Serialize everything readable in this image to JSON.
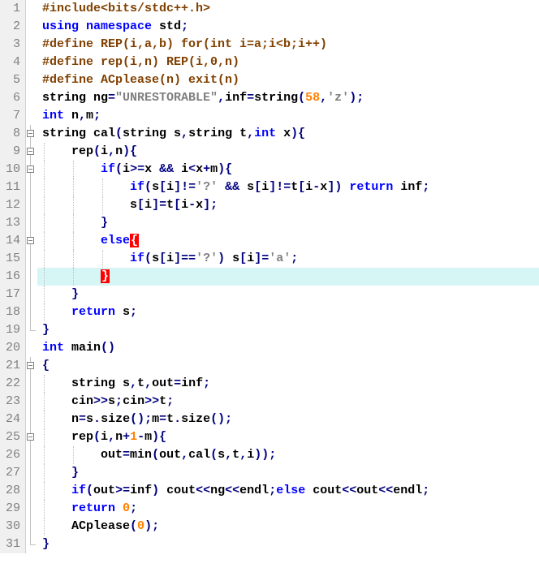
{
  "chart_data": {
    "type": "table",
    "title": "C++ source code listing",
    "lines": [
      {
        "n": 1,
        "fold": "",
        "tokens": [
          [
            "pp",
            "#include<bits/stdc++.h>"
          ]
        ]
      },
      {
        "n": 2,
        "fold": "",
        "tokens": [
          [
            "kw",
            "using"
          ],
          [
            "tok",
            " "
          ],
          [
            "kw",
            "namespace"
          ],
          [
            "tok",
            " std"
          ],
          [
            "pun",
            ";"
          ]
        ]
      },
      {
        "n": 3,
        "fold": "",
        "tokens": [
          [
            "pp",
            "#define REP(i,a,b) for(int i=a;i<b;i++)"
          ]
        ]
      },
      {
        "n": 4,
        "fold": "",
        "tokens": [
          [
            "pp",
            "#define rep(i,n) REP(i,0,n)"
          ]
        ]
      },
      {
        "n": 5,
        "fold": "",
        "tokens": [
          [
            "pp",
            "#define ACplease(n) exit(n)"
          ]
        ]
      },
      {
        "n": 6,
        "fold": "",
        "tokens": [
          [
            "tok",
            "string ng"
          ],
          [
            "pun",
            "="
          ],
          [
            "str",
            "\"UNRESTORABLE\""
          ],
          [
            "pun",
            ","
          ],
          [
            "tok",
            "inf"
          ],
          [
            "pun",
            "="
          ],
          [
            "tok",
            "string"
          ],
          [
            "pun",
            "("
          ],
          [
            "num",
            "58"
          ],
          [
            "pun",
            ","
          ],
          [
            "str",
            "'z'"
          ],
          [
            "pun",
            ");"
          ]
        ]
      },
      {
        "n": 7,
        "fold": "",
        "tokens": [
          [
            "kw",
            "int"
          ],
          [
            "tok",
            " n"
          ],
          [
            "pun",
            ","
          ],
          [
            "tok",
            "m"
          ],
          [
            "pun",
            ";"
          ]
        ]
      },
      {
        "n": 8,
        "fold": "box",
        "tokens": [
          [
            "tok",
            "string cal"
          ],
          [
            "pun",
            "("
          ],
          [
            "tok",
            "string s"
          ],
          [
            "pun",
            ","
          ],
          [
            "tok",
            "string t"
          ],
          [
            "pun",
            ","
          ],
          [
            "kw",
            "int"
          ],
          [
            "tok",
            " x"
          ],
          [
            "pun",
            "){"
          ]
        ]
      },
      {
        "n": 9,
        "fold": "box",
        "indent": 1,
        "tokens": [
          [
            "tok",
            "    rep"
          ],
          [
            "pun",
            "("
          ],
          [
            "tok",
            "i"
          ],
          [
            "pun",
            ","
          ],
          [
            "tok",
            "n"
          ],
          [
            "pun",
            "){"
          ]
        ]
      },
      {
        "n": 10,
        "fold": "box",
        "indent": 2,
        "tokens": [
          [
            "tok",
            "        "
          ],
          [
            "kw",
            "if"
          ],
          [
            "pun",
            "("
          ],
          [
            "tok",
            "i"
          ],
          [
            "pun",
            ">="
          ],
          [
            "tok",
            "x "
          ],
          [
            "pun",
            "&&"
          ],
          [
            "tok",
            " i"
          ],
          [
            "pun",
            "<"
          ],
          [
            "tok",
            "x"
          ],
          [
            "pun",
            "+"
          ],
          [
            "tok",
            "m"
          ],
          [
            "pun",
            "){"
          ]
        ]
      },
      {
        "n": 11,
        "fold": "line",
        "indent": 3,
        "tokens": [
          [
            "tok",
            "            "
          ],
          [
            "kw",
            "if"
          ],
          [
            "pun",
            "("
          ],
          [
            "tok",
            "s"
          ],
          [
            "pun",
            "["
          ],
          [
            "tok",
            "i"
          ],
          [
            "pun",
            "]!="
          ],
          [
            "str",
            "'?'"
          ],
          [
            "tok",
            " "
          ],
          [
            "pun",
            "&&"
          ],
          [
            "tok",
            " s"
          ],
          [
            "pun",
            "["
          ],
          [
            "tok",
            "i"
          ],
          [
            "pun",
            "]!="
          ],
          [
            "tok",
            "t"
          ],
          [
            "pun",
            "["
          ],
          [
            "tok",
            "i"
          ],
          [
            "pun",
            "-"
          ],
          [
            "tok",
            "x"
          ],
          [
            "pun",
            "])"
          ],
          [
            "tok",
            " "
          ],
          [
            "kw",
            "return"
          ],
          [
            "tok",
            " inf"
          ],
          [
            "pun",
            ";"
          ]
        ]
      },
      {
        "n": 12,
        "fold": "line",
        "indent": 3,
        "tokens": [
          [
            "tok",
            "            s"
          ],
          [
            "pun",
            "["
          ],
          [
            "tok",
            "i"
          ],
          [
            "pun",
            "]="
          ],
          [
            "tok",
            "t"
          ],
          [
            "pun",
            "["
          ],
          [
            "tok",
            "i"
          ],
          [
            "pun",
            "-"
          ],
          [
            "tok",
            "x"
          ],
          [
            "pun",
            "];"
          ]
        ]
      },
      {
        "n": 13,
        "fold": "line",
        "indent": 2,
        "tokens": [
          [
            "tok",
            "        "
          ],
          [
            "pun",
            "}"
          ]
        ]
      },
      {
        "n": 14,
        "fold": "box",
        "indent": 2,
        "tokens": [
          [
            "tok",
            "        "
          ],
          [
            "kw",
            "else"
          ],
          [
            "hlbrace",
            "{"
          ]
        ]
      },
      {
        "n": 15,
        "fold": "line",
        "indent": 3,
        "tokens": [
          [
            "tok",
            "            "
          ],
          [
            "kw",
            "if"
          ],
          [
            "pun",
            "("
          ],
          [
            "tok",
            "s"
          ],
          [
            "pun",
            "["
          ],
          [
            "tok",
            "i"
          ],
          [
            "pun",
            "]=="
          ],
          [
            "str",
            "'?'"
          ],
          [
            "pun",
            ")"
          ],
          [
            "tok",
            " s"
          ],
          [
            "pun",
            "["
          ],
          [
            "tok",
            "i"
          ],
          [
            "pun",
            "]="
          ],
          [
            "str",
            "'a'"
          ],
          [
            "pun",
            ";"
          ]
        ]
      },
      {
        "n": 16,
        "fold": "line",
        "indent": 2,
        "hl": true,
        "tokens": [
          [
            "tok",
            "        "
          ],
          [
            "hlbrace",
            "}"
          ]
        ]
      },
      {
        "n": 17,
        "fold": "line",
        "indent": 1,
        "tokens": [
          [
            "tok",
            "    "
          ],
          [
            "pun",
            "}"
          ]
        ]
      },
      {
        "n": 18,
        "fold": "line",
        "indent": 1,
        "tokens": [
          [
            "tok",
            "    "
          ],
          [
            "kw",
            "return"
          ],
          [
            "tok",
            " s"
          ],
          [
            "pun",
            ";"
          ]
        ]
      },
      {
        "n": 19,
        "fold": "end",
        "tokens": [
          [
            "pun",
            "}"
          ]
        ]
      },
      {
        "n": 20,
        "fold": "",
        "tokens": [
          [
            "kw",
            "int"
          ],
          [
            "tok",
            " main"
          ],
          [
            "pun",
            "()"
          ]
        ]
      },
      {
        "n": 21,
        "fold": "box",
        "tokens": [
          [
            "pun",
            "{"
          ]
        ]
      },
      {
        "n": 22,
        "fold": "line",
        "indent": 1,
        "tokens": [
          [
            "tok",
            "    string s"
          ],
          [
            "pun",
            ","
          ],
          [
            "tok",
            "t"
          ],
          [
            "pun",
            ","
          ],
          [
            "tok",
            "out"
          ],
          [
            "pun",
            "="
          ],
          [
            "tok",
            "inf"
          ],
          [
            "pun",
            ";"
          ]
        ]
      },
      {
        "n": 23,
        "fold": "line",
        "indent": 1,
        "tokens": [
          [
            "tok",
            "    cin"
          ],
          [
            "pun",
            ">>"
          ],
          [
            "tok",
            "s"
          ],
          [
            "pun",
            ";"
          ],
          [
            "tok",
            "cin"
          ],
          [
            "pun",
            ">>"
          ],
          [
            "tok",
            "t"
          ],
          [
            "pun",
            ";"
          ]
        ]
      },
      {
        "n": 24,
        "fold": "line",
        "indent": 1,
        "tokens": [
          [
            "tok",
            "    n"
          ],
          [
            "pun",
            "="
          ],
          [
            "tok",
            "s"
          ],
          [
            "pun",
            "."
          ],
          [
            "tok",
            "size"
          ],
          [
            "pun",
            "();"
          ],
          [
            "tok",
            "m"
          ],
          [
            "pun",
            "="
          ],
          [
            "tok",
            "t"
          ],
          [
            "pun",
            "."
          ],
          [
            "tok",
            "size"
          ],
          [
            "pun",
            "();"
          ]
        ]
      },
      {
        "n": 25,
        "fold": "box",
        "indent": 1,
        "tokens": [
          [
            "tok",
            "    rep"
          ],
          [
            "pun",
            "("
          ],
          [
            "tok",
            "i"
          ],
          [
            "pun",
            ","
          ],
          [
            "tok",
            "n"
          ],
          [
            "pun",
            "+"
          ],
          [
            "num",
            "1"
          ],
          [
            "pun",
            "-"
          ],
          [
            "tok",
            "m"
          ],
          [
            "pun",
            "){"
          ]
        ]
      },
      {
        "n": 26,
        "fold": "line",
        "indent": 2,
        "tokens": [
          [
            "tok",
            "        out"
          ],
          [
            "pun",
            "="
          ],
          [
            "tok",
            "min"
          ],
          [
            "pun",
            "("
          ],
          [
            "tok",
            "out"
          ],
          [
            "pun",
            ","
          ],
          [
            "tok",
            "cal"
          ],
          [
            "pun",
            "("
          ],
          [
            "tok",
            "s"
          ],
          [
            "pun",
            ","
          ],
          [
            "tok",
            "t"
          ],
          [
            "pun",
            ","
          ],
          [
            "tok",
            "i"
          ],
          [
            "pun",
            "));"
          ]
        ]
      },
      {
        "n": 27,
        "fold": "line",
        "indent": 1,
        "tokens": [
          [
            "tok",
            "    "
          ],
          [
            "pun",
            "}"
          ]
        ]
      },
      {
        "n": 28,
        "fold": "line",
        "indent": 1,
        "tokens": [
          [
            "tok",
            "    "
          ],
          [
            "kw",
            "if"
          ],
          [
            "pun",
            "("
          ],
          [
            "tok",
            "out"
          ],
          [
            "pun",
            ">="
          ],
          [
            "tok",
            "inf"
          ],
          [
            "pun",
            ")"
          ],
          [
            "tok",
            " cout"
          ],
          [
            "pun",
            "<<"
          ],
          [
            "tok",
            "ng"
          ],
          [
            "pun",
            "<<"
          ],
          [
            "tok",
            "endl"
          ],
          [
            "pun",
            ";"
          ],
          [
            "kw",
            "else"
          ],
          [
            "tok",
            " cout"
          ],
          [
            "pun",
            "<<"
          ],
          [
            "tok",
            "out"
          ],
          [
            "pun",
            "<<"
          ],
          [
            "tok",
            "endl"
          ],
          [
            "pun",
            ";"
          ]
        ]
      },
      {
        "n": 29,
        "fold": "line",
        "indent": 1,
        "tokens": [
          [
            "tok",
            "    "
          ],
          [
            "kw",
            "return"
          ],
          [
            "tok",
            " "
          ],
          [
            "num",
            "0"
          ],
          [
            "pun",
            ";"
          ]
        ]
      },
      {
        "n": 30,
        "fold": "line",
        "indent": 1,
        "tokens": [
          [
            "tok",
            "    ACplease"
          ],
          [
            "pun",
            "("
          ],
          [
            "num",
            "0"
          ],
          [
            "pun",
            ");"
          ]
        ]
      },
      {
        "n": 31,
        "fold": "end",
        "tokens": [
          [
            "pun",
            "}"
          ]
        ]
      }
    ]
  },
  "colors": {
    "keyword": "#0000ff",
    "preprocessor": "#804000",
    "string": "#808080",
    "number": "#ff8000",
    "punct": "#000080",
    "highlight_bg": "#d6f5f5",
    "brace_match_bg": "#ff0000"
  }
}
